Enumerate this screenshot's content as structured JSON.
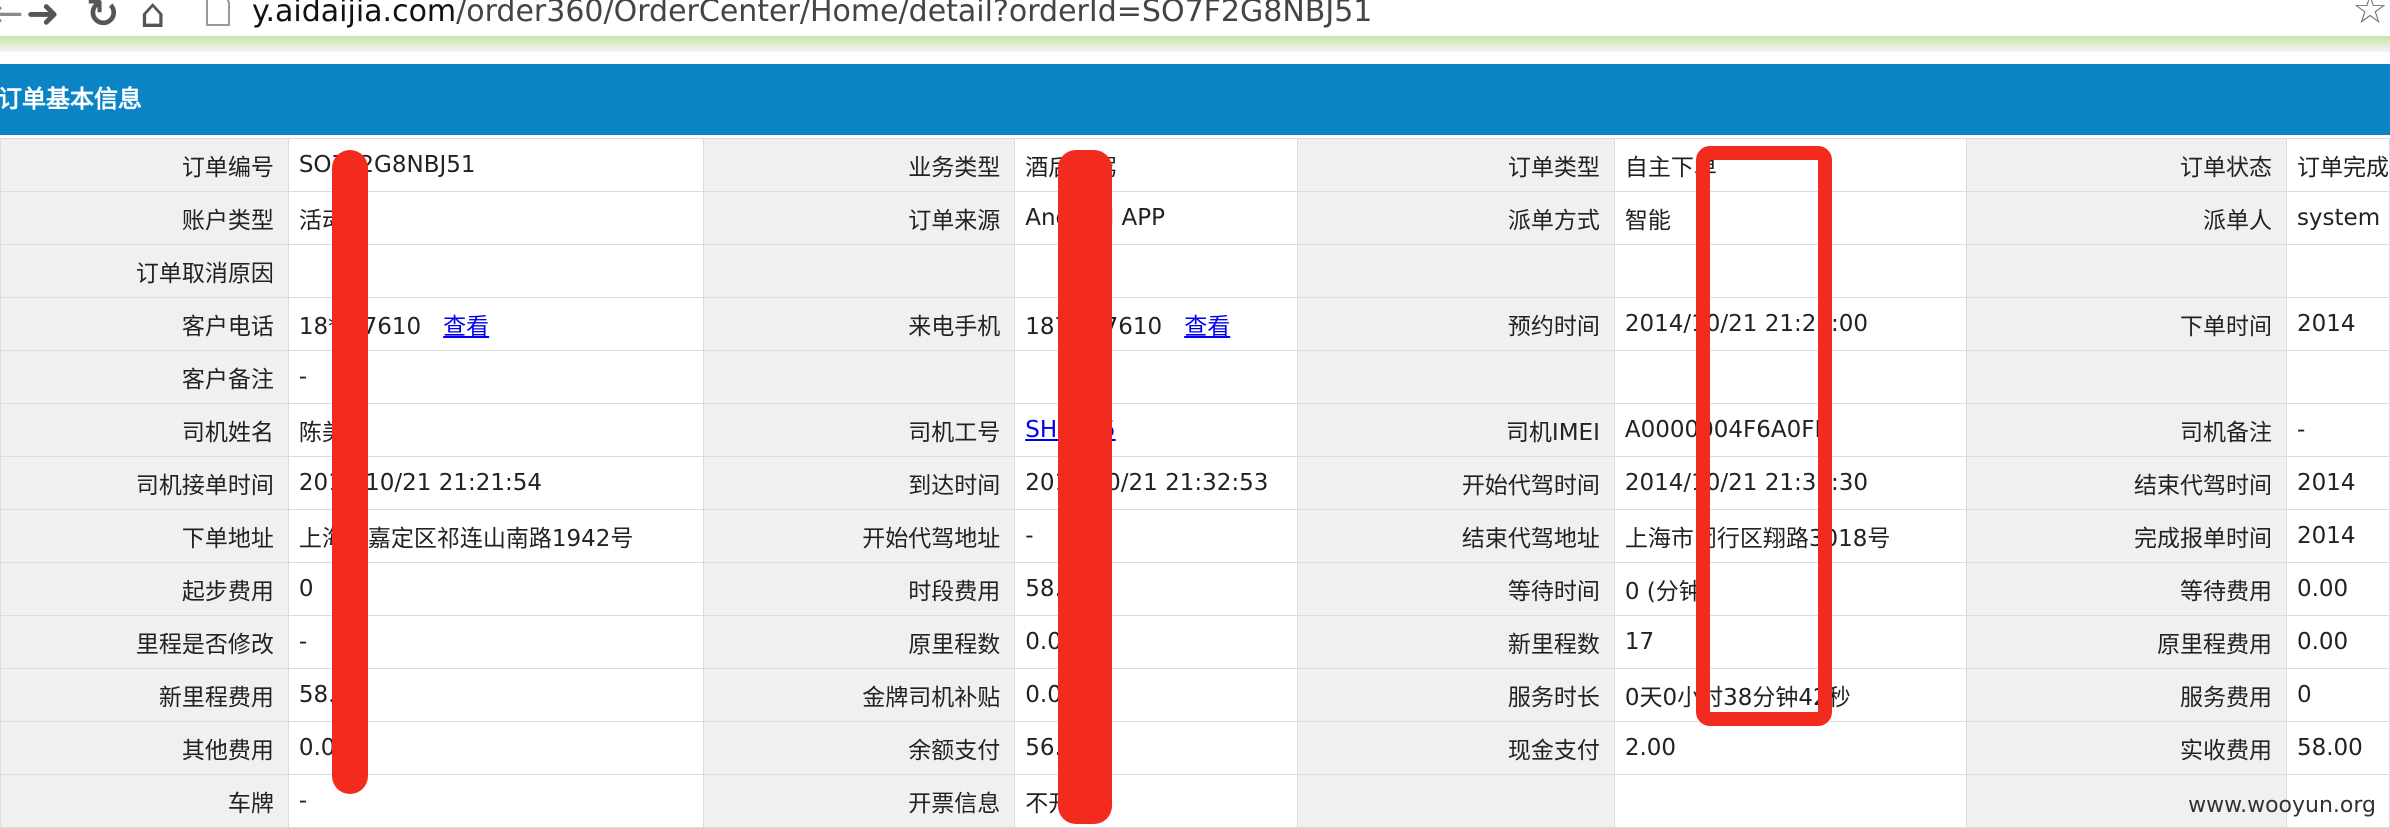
{
  "browser": {
    "url_host": "y.aidaijia.com",
    "url_path": "/order360/OrderCenter/Home/detail?orderId=SO7F2G8NBJ51"
  },
  "section": {
    "title": "订单基本信息"
  },
  "rows": [
    [
      {
        "label": "订单编号",
        "value": "SO7F2G8NBJ51"
      },
      {
        "label": "业务类型",
        "value": "酒后代驾"
      },
      {
        "label": "订单类型",
        "value": "自主下单"
      },
      {
        "label": "订单状态",
        "value": "订单完成"
      }
    ],
    [
      {
        "label": "账户类型",
        "value": "活动"
      },
      {
        "label": "订单来源",
        "value": "Android APP"
      },
      {
        "label": "派单方式",
        "value": "智能"
      },
      {
        "label": "派单人",
        "value": "system"
      }
    ],
    [
      {
        "label": "订单取消原因",
        "value": ""
      },
      {
        "label": "",
        "value": ""
      },
      {
        "label": "",
        "value": ""
      },
      {
        "label": "",
        "value": ""
      }
    ],
    [
      {
        "label": "客户电话",
        "value": "18***7610",
        "link": "查看"
      },
      {
        "label": "来电手机",
        "value": "187***7610",
        "link": "查看"
      },
      {
        "label": "预约时间",
        "value": "2014/10/21 21:20:00"
      },
      {
        "label": "下单时间",
        "value": "2014"
      }
    ],
    [
      {
        "label": "客户备注",
        "value": "-"
      },
      {
        "label": "",
        "value": ""
      },
      {
        "label": "",
        "value": ""
      },
      {
        "label": "",
        "value": ""
      }
    ],
    [
      {
        "label": "司机姓名",
        "value": "陈美"
      },
      {
        "label": "司机工号",
        "value": "SH3145",
        "is_link": true
      },
      {
        "label": "司机IMEI",
        "value": "A0000004F6A0FE"
      },
      {
        "label": "司机备注",
        "value": "-"
      }
    ],
    [
      {
        "label": "司机接单时间",
        "value": "2014/10/21 21:21:54"
      },
      {
        "label": "到达时间",
        "value": "2014/10/21 21:32:53"
      },
      {
        "label": "开始代驾时间",
        "value": "2014/10/21 21:35:30"
      },
      {
        "label": "结束代驾时间",
        "value": "2014"
      }
    ],
    [
      {
        "label": "下单地址",
        "value": "上海市嘉定区祁连山南路1942号"
      },
      {
        "label": "开始代驾地址",
        "value": "-"
      },
      {
        "label": "结束代驾地址",
        "value": "上海市闵行区翔路3018号"
      },
      {
        "label": "完成报单时间",
        "value": "2014"
      }
    ],
    [
      {
        "label": "起步费用",
        "value": "0"
      },
      {
        "label": "时段费用",
        "value": "58.00"
      },
      {
        "label": "等待时间",
        "value": "0 (分钟)"
      },
      {
        "label": "等待费用",
        "value": "0.00"
      }
    ],
    [
      {
        "label": "里程是否修改",
        "value": "-"
      },
      {
        "label": "原里程数",
        "value": "0.00"
      },
      {
        "label": "新里程数",
        "value": "17"
      },
      {
        "label": "原里程费用",
        "value": "0.00"
      }
    ],
    [
      {
        "label": "新里程费用",
        "value": "58.00"
      },
      {
        "label": "金牌司机补贴",
        "value": "0.00"
      },
      {
        "label": "服务时长",
        "value": "0天0小时38分钟42秒"
      },
      {
        "label": "服务费用",
        "value": "0"
      }
    ],
    [
      {
        "label": "其他费用",
        "value": "0.00"
      },
      {
        "label": "余额支付",
        "value": "56.00"
      },
      {
        "label": "现金支付",
        "value": "2.00"
      },
      {
        "label": "实收费用",
        "value": "58.00"
      }
    ],
    [
      {
        "label": "车牌",
        "value": "-"
      },
      {
        "label": "开票信息",
        "value": "不开票"
      },
      {
        "label": "",
        "value": ""
      },
      {
        "label": "",
        "value": ""
      }
    ]
  ],
  "watermark": "www.wooyun.org",
  "colors": {
    "header_blue": "#0b84c6",
    "redaction_red": "#f32b1e",
    "label_bg": "#f0f0f0"
  }
}
